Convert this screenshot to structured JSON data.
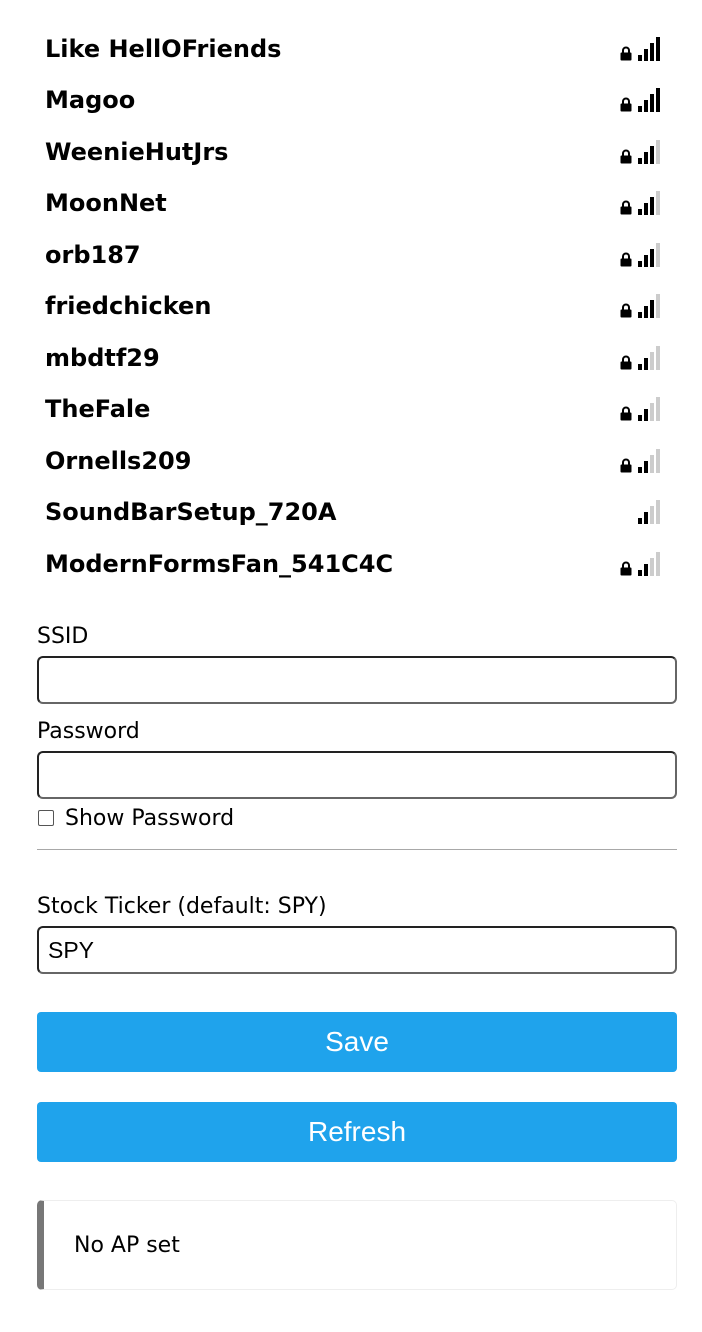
{
  "networks": [
    {
      "ssid": "Like HellOFriends",
      "secured": true,
      "bars": 4
    },
    {
      "ssid": "Magoo",
      "secured": true,
      "bars": 4
    },
    {
      "ssid": "WeenieHutJrs",
      "secured": true,
      "bars": 3
    },
    {
      "ssid": "MoonNet",
      "secured": true,
      "bars": 3
    },
    {
      "ssid": "orb187",
      "secured": true,
      "bars": 3
    },
    {
      "ssid": "friedchicken",
      "secured": true,
      "bars": 3
    },
    {
      "ssid": "mbdtf29",
      "secured": true,
      "bars": 2
    },
    {
      "ssid": "TheFale",
      "secured": true,
      "bars": 2
    },
    {
      "ssid": "Ornells209",
      "secured": true,
      "bars": 2
    },
    {
      "ssid": "SoundBarSetup_720A",
      "secured": false,
      "bars": 2
    },
    {
      "ssid": "ModernFormsFan_541C4C",
      "secured": true,
      "bars": 2
    }
  ],
  "form": {
    "ssid_label": "SSID",
    "ssid_value": "",
    "password_label": "Password",
    "password_value": "",
    "show_password_label": "Show Password",
    "show_password_checked": false,
    "ticker_label": "Stock Ticker (default: SPY)",
    "ticker_value": "SPY"
  },
  "buttons": {
    "save_label": "Save",
    "refresh_label": "Refresh"
  },
  "status": {
    "message": "No AP set"
  },
  "colors": {
    "button_bg": "#1fa3ec",
    "button_text": "#ffffff",
    "signal_on": "#000000",
    "signal_off": "#cccccc",
    "status_border": "#777777"
  },
  "icons": {
    "lock": "lock-icon",
    "signal": "signal-strength-icon"
  }
}
